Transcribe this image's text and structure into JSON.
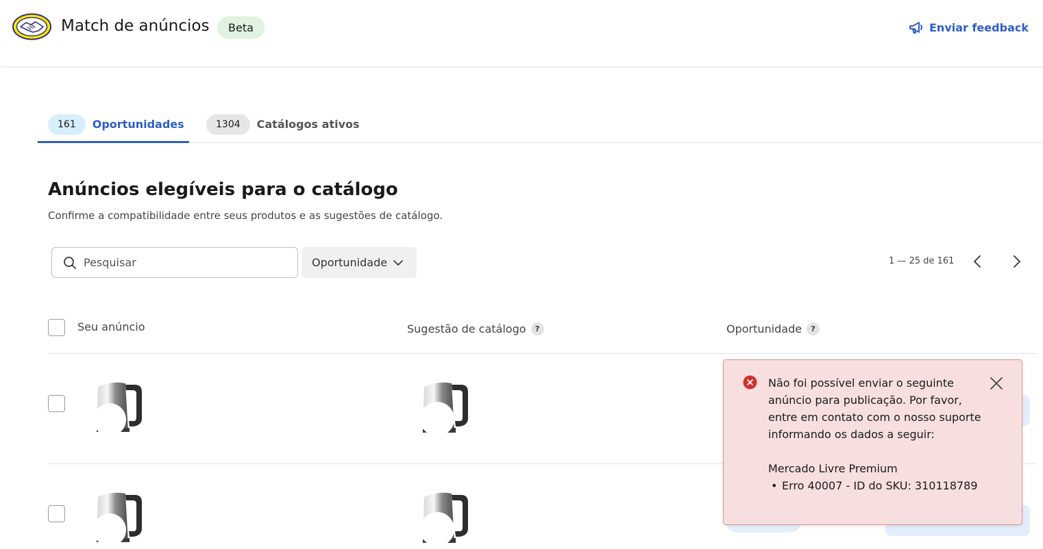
{
  "header": {
    "logo_icon": "mercado-livre-handshake-logo",
    "title": "Match de anúncios",
    "badge": "Beta",
    "feedback_label": "Enviar feedback",
    "feedback_icon": "megaphone-icon",
    "accent_color": "#2d5ec4"
  },
  "tabs": [
    {
      "count": "161",
      "label": "Oportunidades",
      "active": true
    },
    {
      "count": "1304",
      "label": "Catálogos ativos",
      "active": false
    }
  ],
  "main": {
    "title": "Anúncios elegíveis para o catálogo",
    "subtitle": "Confirme a compatibilidade entre seus produtos e as sugestões de catálogo."
  },
  "toolbar": {
    "search_placeholder": "Pesquisar",
    "search_value": "",
    "filter_label": "Oportunidade",
    "pagination_text": "1 — 25 de 161"
  },
  "table": {
    "columns": [
      "Seu anúncio",
      "Sugestão de catálogo",
      "Oportunidade"
    ],
    "help_glyph": "?",
    "rows": [
      {
        "listing_image": "kettle-image",
        "catalog_image": "kettle-image",
        "checked": false
      },
      {
        "listing_image": "kettle-image",
        "catalog_image": "kettle-image",
        "checked": false
      }
    ]
  },
  "toast": {
    "type": "error",
    "error_color": "#d0312d",
    "message": "Não foi possível enviar o seguinte anúncio para publicação. Por favor, entre em contato com o nosso suporte informando os dados a seguir:",
    "account": "Mercado Livre Premium",
    "errors": [
      "Erro 40007 - ID do SKU: 310118789"
    ]
  }
}
